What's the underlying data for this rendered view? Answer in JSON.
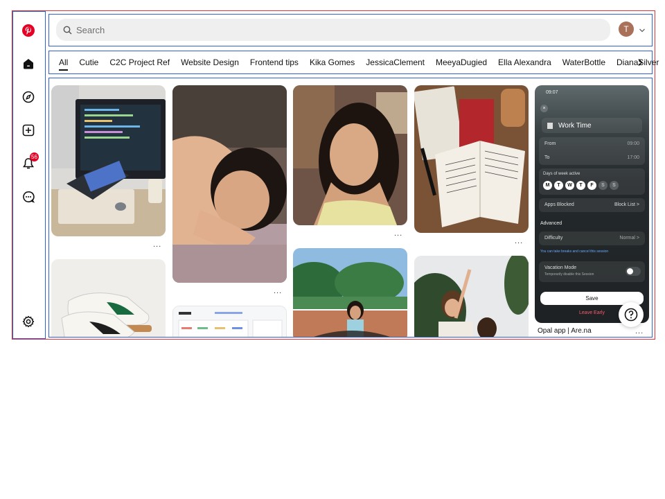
{
  "app": {
    "brand_color": "#e60023"
  },
  "sidebar": {
    "items": [
      {
        "name": "pinterest-logo-icon"
      },
      {
        "name": "home-icon"
      },
      {
        "name": "explore-compass-icon"
      },
      {
        "name": "create-plus-icon"
      },
      {
        "name": "notifications-bell-icon",
        "badge": "56"
      },
      {
        "name": "messages-icon"
      },
      {
        "name": "settings-gear-icon"
      }
    ]
  },
  "header": {
    "search_placeholder": "Search",
    "avatar_initial": "T"
  },
  "tabs": [
    "All",
    "Cutie",
    "C2C Project Ref",
    "Website Design",
    "Frontend tips",
    "Kika Gomes",
    "JessicaClement",
    "MeeyaDugied",
    "Ella Alexandra",
    "WaterBottle",
    "DianaSilver"
  ],
  "pins": {
    "more_label": "...",
    "opal_caption": "Opal app | Are.na"
  },
  "opal": {
    "status_time": "09:07",
    "title": "Work Time",
    "from_label": "From",
    "from_value": "09:00",
    "to_label": "To",
    "to_value": "17:00",
    "days_label": "Days of week active",
    "days": [
      "M",
      "T",
      "W",
      "T",
      "F",
      "S",
      "S"
    ],
    "apps_blocked_label": "Apps Blocked",
    "apps_blocked_value": "Block List >",
    "advanced_label": "Advanced",
    "difficulty_label": "Difficulty",
    "difficulty_value": "Normal >",
    "break_note": "You can take breaks and cancel this session",
    "vacation_label": "Vacation Mode",
    "vacation_sub": "Temporarily disable this Session",
    "save_label": "Save",
    "leave_label": "Leave Early"
  }
}
